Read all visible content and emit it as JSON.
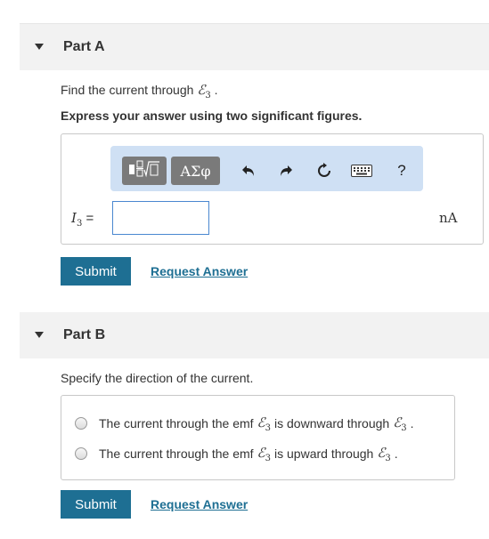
{
  "partA": {
    "title": "Part A",
    "question_prefix": "Find the current through",
    "question_emf": "ℰ",
    "question_emf_sub": "3",
    "question_suffix": ".",
    "instruction": "Express your answer using two significant figures.",
    "toolbar": {
      "templates_icon": "fraction-sqrt-icon",
      "symbols_label": "ΑΣφ",
      "undo_icon": "undo-icon",
      "redo_icon": "redo-icon",
      "reset_icon": "reset-icon",
      "keyboard_icon": "keyboard-icon",
      "help_label": "?"
    },
    "variable": "I",
    "variable_sub": "3",
    "equals": "=",
    "answer_value": "",
    "unit": "nA",
    "submit_label": "Submit",
    "request_label": "Request Answer"
  },
  "partB": {
    "title": "Part B",
    "question": "Specify the direction of the current.",
    "options": [
      {
        "prefix": "The current through the emf",
        "emf": "ℰ",
        "emf_sub": "3",
        "middle": "is downward through",
        "end_emf": "ℰ",
        "end_sub": "3",
        "end": "."
      },
      {
        "prefix": "The current through the emf",
        "emf": "ℰ",
        "emf_sub": "3",
        "middle": "is upward through",
        "end_emf": "ℰ",
        "end_sub": "3",
        "end": "."
      }
    ],
    "submit_label": "Submit",
    "request_label": "Request Answer"
  },
  "colors": {
    "accent": "#1e6f93",
    "toolbar_bg": "#cfe0f4",
    "toolbar_button": "#7a7a7a",
    "header_bg": "#f2f2f2",
    "input_border": "#4a87d0"
  }
}
